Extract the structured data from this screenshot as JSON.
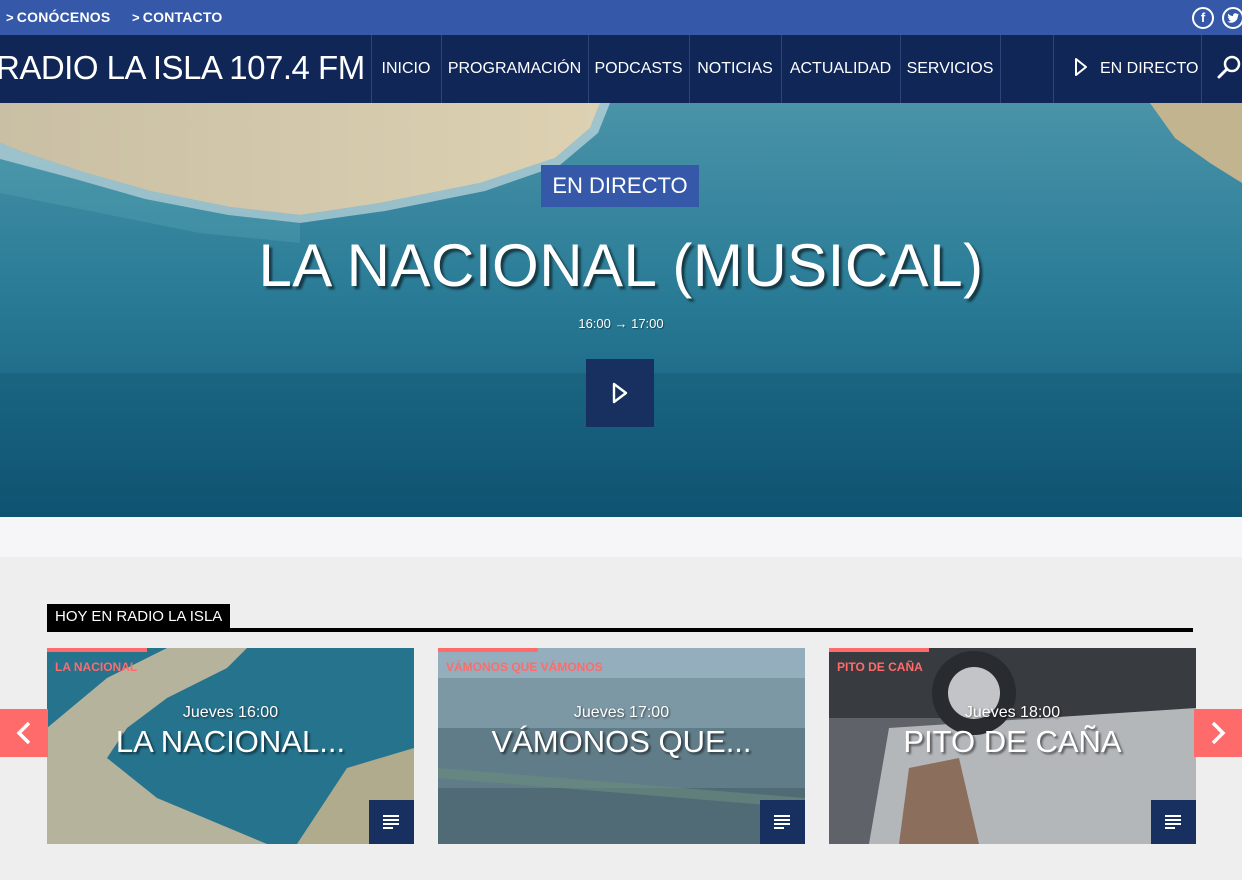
{
  "topbar": {
    "links": [
      {
        "label": "CONÓCENOS",
        "chevron": ">"
      },
      {
        "label": "CONTACTO",
        "chevron": ">"
      }
    ],
    "social": [
      {
        "icon": "facebook-icon",
        "glyph": "f"
      },
      {
        "icon": "twitter-icon",
        "glyph": "t"
      }
    ]
  },
  "nav": {
    "brand": "RADIO LA ISLA 107.4 FM",
    "items": [
      "INICIO",
      "PROGRAMACIÓN",
      "PODCASTS",
      "NOTICIAS",
      "ACTUALIDAD",
      "SERVICIOS"
    ],
    "live_label": "EN DIRECTO",
    "search_icon": "search-icon"
  },
  "hero": {
    "badge": "EN DIRECTO",
    "title": "LA NACIONAL (MUSICAL)",
    "time": "16:00 → 17:00",
    "play_icon": "play-icon"
  },
  "section": {
    "title": "HOY EN RADIO LA ISLA",
    "cards": [
      {
        "category": "LA NACIONAL",
        "day": "Jueves 16:00",
        "title": "LA NACIONAL..."
      },
      {
        "category": "VÁMONOS QUE VÁMONOS",
        "day": "Jueves 17:00",
        "title": "VÁMONOS QUE..."
      },
      {
        "category": "PITO DE CAÑA",
        "day": "Jueves 18:00",
        "title": "PITO DE CAÑA"
      }
    ]
  },
  "colors": {
    "topbar": "#3559a8",
    "nav": "#0f2657",
    "accent": "#ff6b6b",
    "button": "#17305f"
  }
}
